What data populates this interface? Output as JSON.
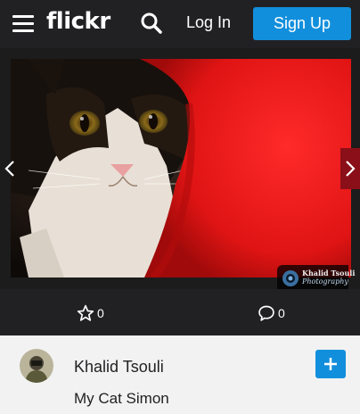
{
  "header": {
    "logo": "flickr",
    "login_label": "Log In",
    "signup_label": "Sign Up",
    "icons": [
      "menu-icon",
      "search-icon"
    ]
  },
  "photo": {
    "watermark_name": "Khalid Tsouli",
    "watermark_sub": "Photography"
  },
  "actions": {
    "favorites_count": "0",
    "comments_count": "0"
  },
  "info": {
    "author": "Khalid Tsouli",
    "title": "My Cat Simon"
  },
  "colors": {
    "header_bg": "#212124",
    "accent": "#128fdc",
    "page_bg": "#f2f2f2"
  }
}
